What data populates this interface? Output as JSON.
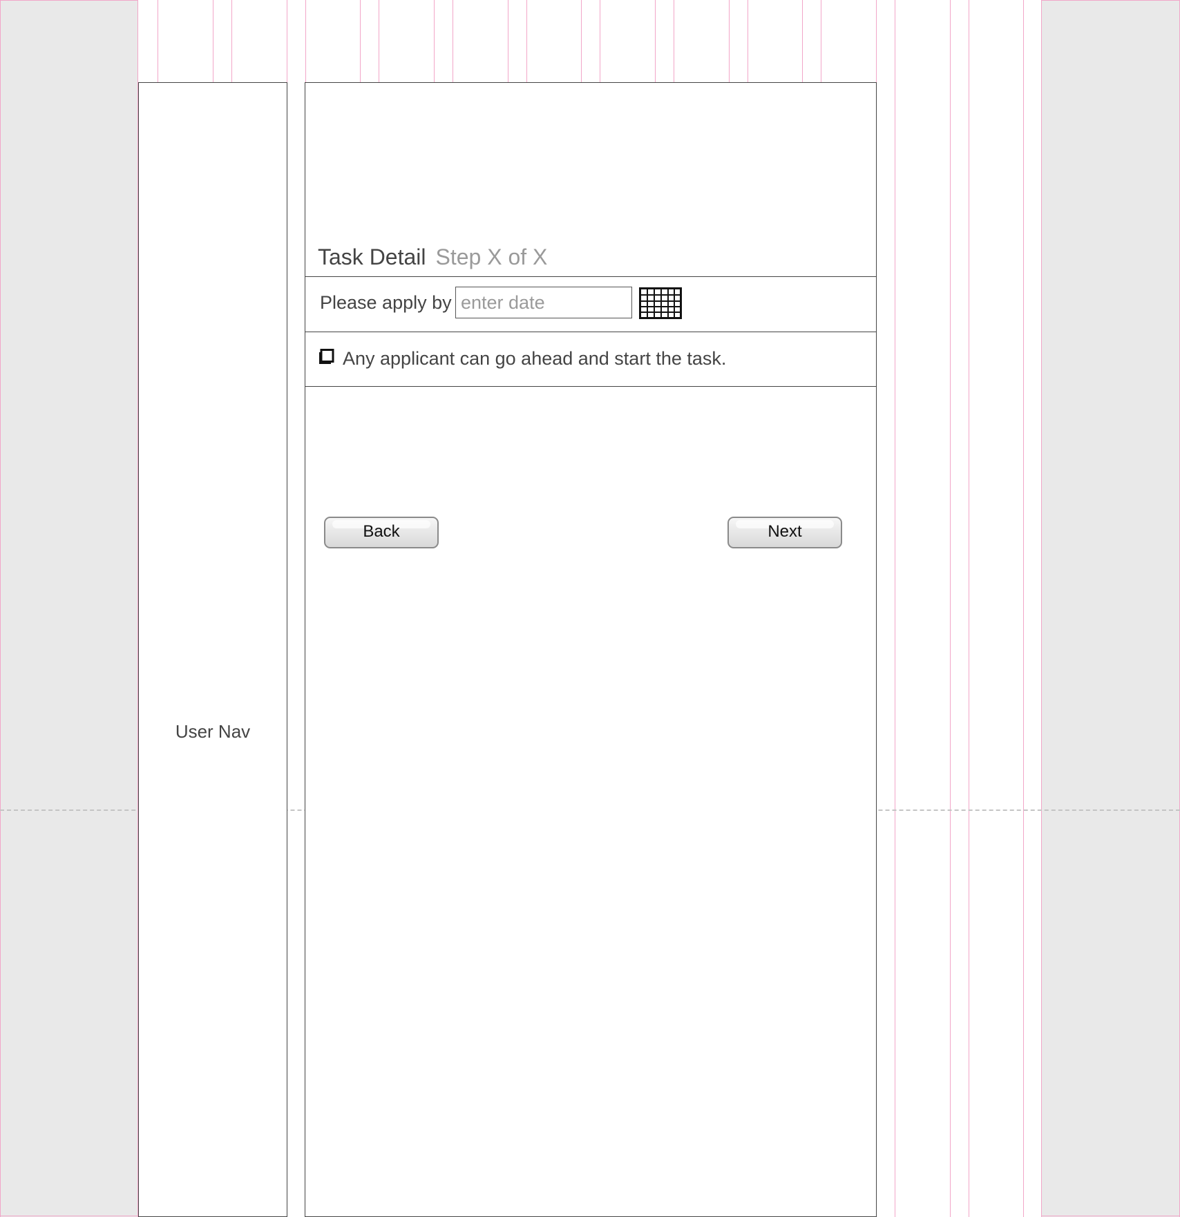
{
  "user_nav": {
    "label": "User Nav"
  },
  "task": {
    "title": "Task Detail",
    "step": "Step X of X"
  },
  "apply_by": {
    "label": "Please apply by",
    "value": "",
    "placeholder": "enter date",
    "icon": "calendar-icon"
  },
  "start_option": {
    "label": "Any applicant can go ahead and start the task.",
    "checked": false,
    "icon": "checkbox-icon"
  },
  "buttons": {
    "back_label": "Back",
    "next_label": "Next"
  },
  "colors": {
    "guide_pink": "#f2a6c8",
    "gutter_gray": "#e9e9e9",
    "text_dark": "#444444",
    "text_muted": "#9a9a9a"
  }
}
